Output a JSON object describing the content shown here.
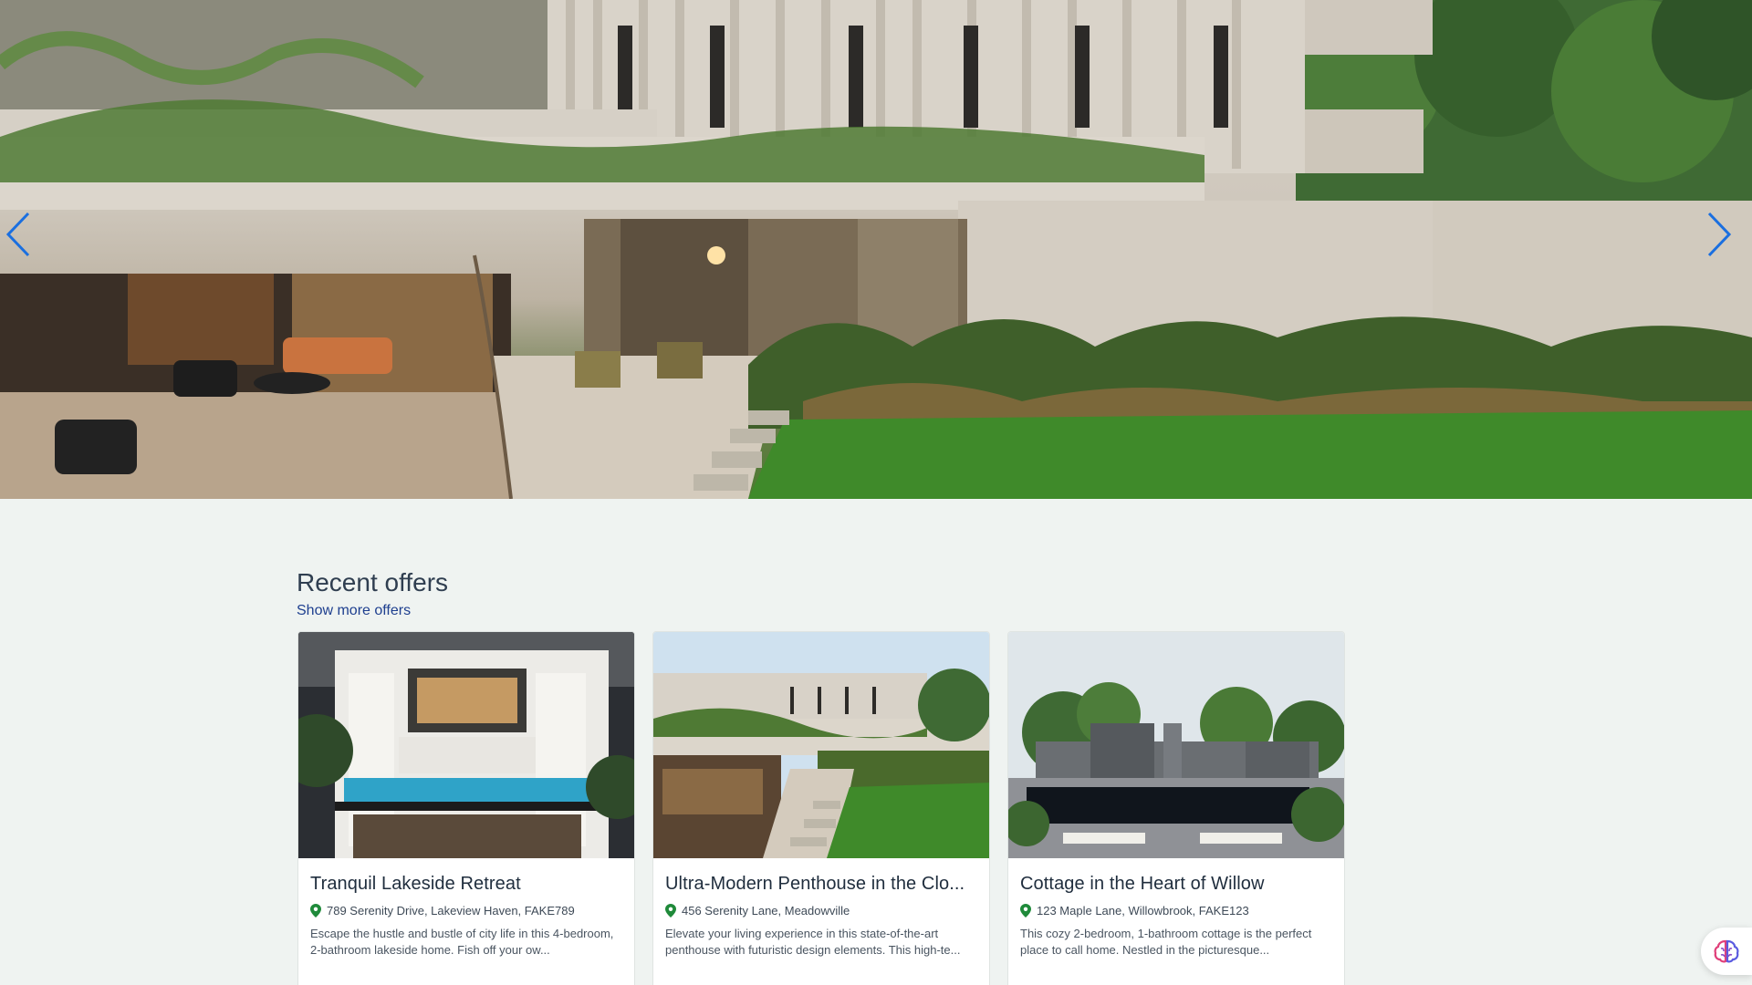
{
  "hero": {
    "prev_icon": "chevron-left-icon",
    "next_icon": "chevron-right-icon",
    "arrow_color": "#1a6fe0"
  },
  "offers": {
    "title": "Recent offers",
    "show_more": "Show more offers",
    "items": [
      {
        "title": "Tranquil Lakeside Retreat",
        "address": "789 Serenity Drive, Lakeview Haven, FAKE789",
        "description": "Escape the hustle and bustle of city life in this 4-bedroom, 2-bathroom lakeside home. Fish off your ow..."
      },
      {
        "title": "Ultra-Modern Penthouse in the Clo...",
        "address": "456 Serenity Lane, Meadowville",
        "description": "Elevate your living experience in this state-of-the-art penthouse with futuristic design elements. This high-te..."
      },
      {
        "title": "Cottage in the Heart of Willow",
        "address": "123 Maple Lane, Willowbrook, FAKE123",
        "description": "This cozy 2-bedroom, 1-bathroom cottage is the perfect place to call home. Nestled in the picturesque..."
      }
    ]
  },
  "assistant": {
    "icon": "brain-icon"
  },
  "colors": {
    "pin": "#1f8a3a",
    "link": "#1e3f8f",
    "background": "#eff3f1"
  }
}
